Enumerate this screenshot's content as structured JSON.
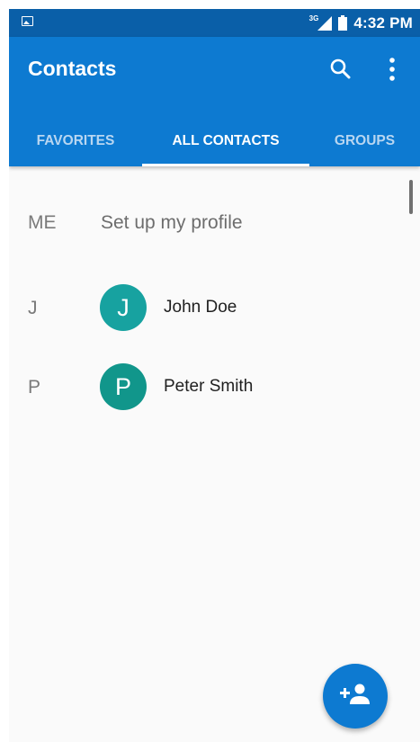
{
  "status_bar": {
    "network_type": "3G",
    "time": "4:32 PM",
    "icons": [
      "image-notification-icon",
      "signal-icon",
      "battery-icon"
    ]
  },
  "app_bar": {
    "title": "Contacts",
    "actions": [
      "search-icon",
      "overflow-menu-icon"
    ]
  },
  "tabs": [
    {
      "label": "FAVORITES",
      "active": false
    },
    {
      "label": "ALL CONTACTS",
      "active": true
    },
    {
      "label": "GROUPS",
      "active": false
    }
  ],
  "me_row": {
    "section": "ME",
    "label": "Set up my profile"
  },
  "contacts": [
    {
      "section": "J",
      "initial": "J",
      "name": "John Doe",
      "avatar_color": "#17a2a0"
    },
    {
      "section": "P",
      "initial": "P",
      "name": "Peter Smith",
      "avatar_color": "#11968b"
    }
  ],
  "fab": {
    "icon": "add-person-icon"
  },
  "colors": {
    "status_bar": "#0a5fa8",
    "primary": "#0d7ad1",
    "background": "#fafafa"
  }
}
